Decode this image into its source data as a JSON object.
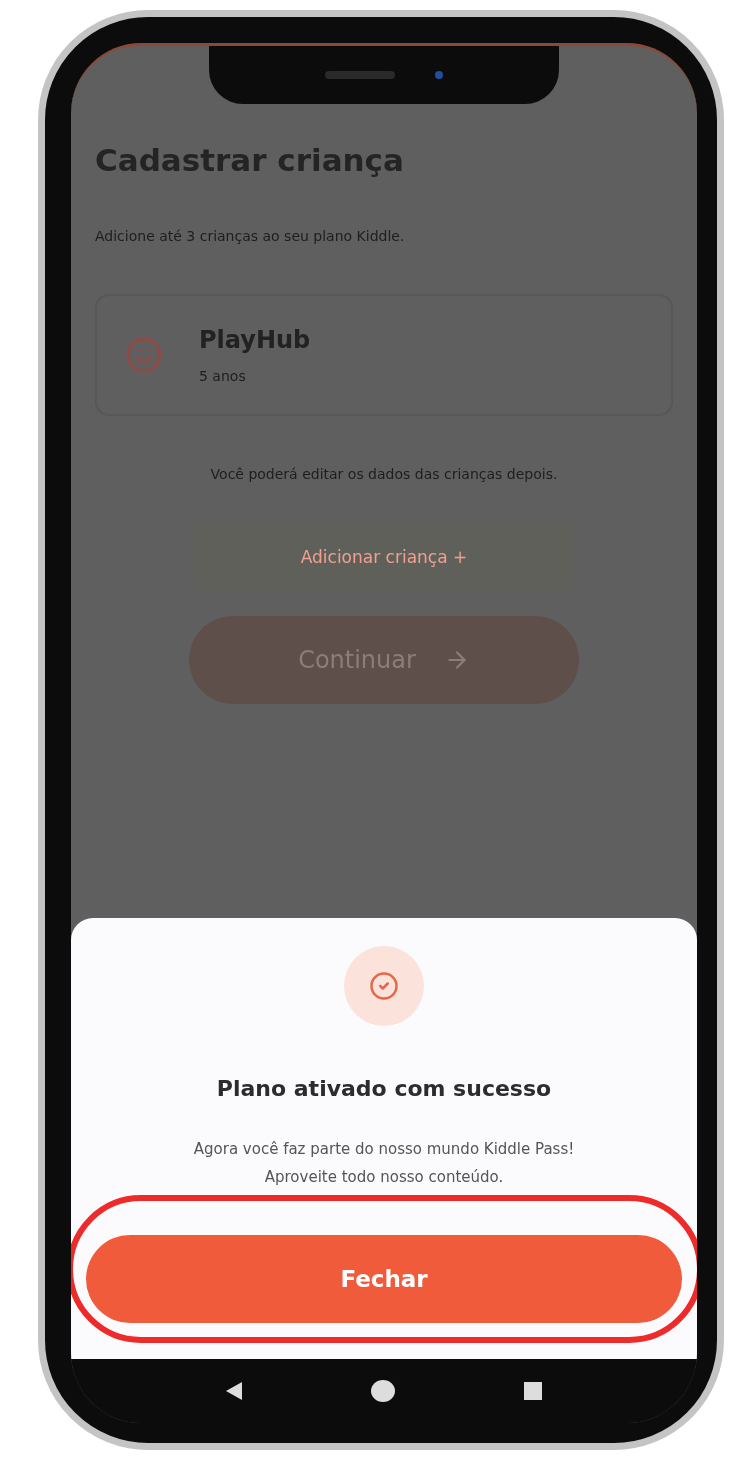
{
  "screen": {
    "title": "Cadastrar criança",
    "subtitle": "Adicione até 3 crianças ao seu plano Kiddle.",
    "children": [
      {
        "name": "PlayHub",
        "age": "5 anos"
      }
    ],
    "note": "Você poderá editar os dados das crianças depois.",
    "add_button": "Adicionar criança +",
    "continue_button": "Continuar"
  },
  "dialog": {
    "title": "Plano ativado com sucesso",
    "message": "Agora você faz parte do nosso mundo Kiddle Pass!\nAproveite todo nosso conteúdo.",
    "button": "Fechar",
    "highlighted": true
  }
}
